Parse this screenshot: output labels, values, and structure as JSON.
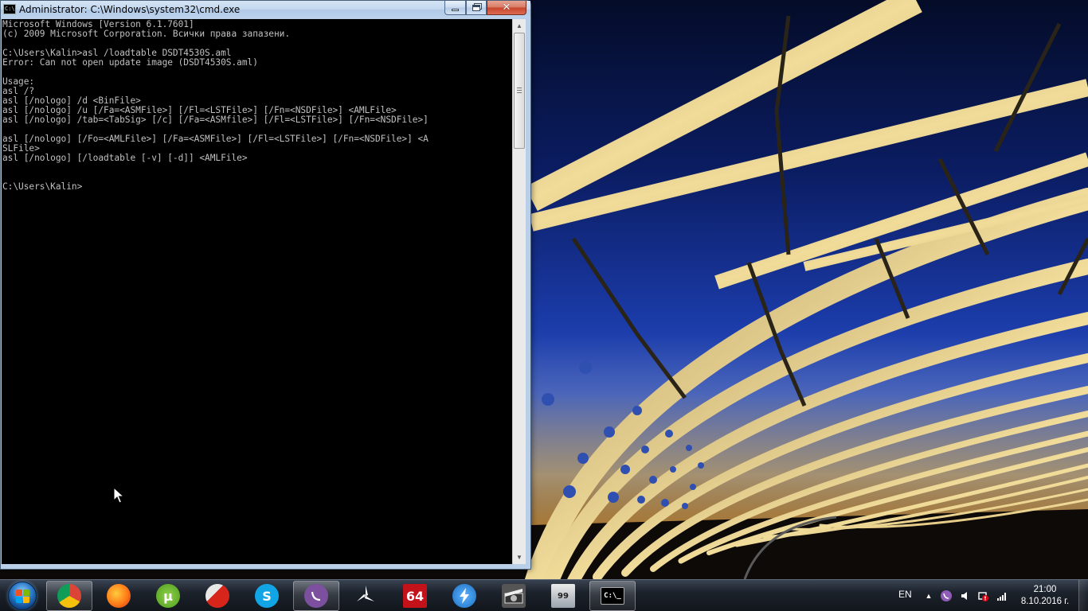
{
  "window": {
    "title": "Administrator: C:\\Windows\\system32\\cmd.exe",
    "icon_label": "C:\\",
    "controls": {
      "minimize": "minimize-icon",
      "maximize": "maximize-icon",
      "close": "close-icon"
    }
  },
  "console": {
    "lines": [
      "Microsoft Windows [Version 6.1.7601]",
      "(c) 2009 Microsoft Corporation. Всички права запазени.",
      "",
      "C:\\Users\\Kalin>asl /loadtable DSDT4530S.aml",
      "Error: Can not open update image (DSDT4530S.aml)",
      "",
      "Usage:",
      "asl /?",
      "asl [/nologo] /d <BinFile>",
      "asl [/nologo] /u [/Fa=<ASMFile>] [/Fl=<LSTFile>] [/Fn=<NSDFile>] <AMLFile>",
      "asl [/nologo] /tab=<TabSig> [/c] [/Fa=<ASMfile>] [/Fl=<LSTFile>] [/Fn=<NSDFile>]",
      "",
      "asl [/nologo] [/Fo=<AMLFile>] [/Fa=<ASMFile>] [/Fl=<LSTFile>] [/Fn=<NSDFile>] <A",
      "SLFile>",
      "asl [/nologo] [/loadtable [-v] [-d]] <AMLFile>",
      "",
      "",
      "C:\\Users\\Kalin>"
    ]
  },
  "taskbar": {
    "start_icon": "windows-logo-icon",
    "items": [
      {
        "name": "chrome",
        "icon": "chrome-icon",
        "label": "",
        "active": true
      },
      {
        "name": "firefox",
        "icon": "firefox-icon",
        "label": "",
        "active": false
      },
      {
        "name": "utorrent",
        "icon": "utorrent-icon",
        "label": "µ",
        "active": false
      },
      {
        "name": "ccleaner",
        "icon": "ccleaner-icon",
        "label": "",
        "active": false
      },
      {
        "name": "skype",
        "icon": "skype-icon",
        "label": "S",
        "active": false
      },
      {
        "name": "viber",
        "icon": "viber-icon",
        "label": "",
        "active": true
      },
      {
        "name": "pinwheel",
        "icon": "pinwheel-icon",
        "label": "",
        "active": false
      },
      {
        "name": "aida64",
        "icon": "aida64-icon",
        "label": "64",
        "active": false
      },
      {
        "name": "bolt",
        "icon": "lightning-icon",
        "label": "",
        "active": false
      },
      {
        "name": "video",
        "icon": "video-clapper-icon",
        "label": "",
        "active": false
      },
      {
        "name": "monitor",
        "icon": "monitor-icon",
        "label": "99",
        "active": false
      },
      {
        "name": "cmd",
        "icon": "cmd-icon",
        "label": "C:\\_",
        "active": true
      }
    ]
  },
  "tray": {
    "language": "EN",
    "icons": [
      "show-hidden-icon",
      "viber-tray-icon",
      "volume-icon",
      "network-warning-icon",
      "signal-icon"
    ],
    "time": "21:00",
    "date": "8.10.2016 г."
  },
  "colors": {
    "console_bg": "#000000",
    "console_fg": "#c0c0c0",
    "titlebar": "#bcd2ec",
    "close_button": "#c7442b"
  }
}
